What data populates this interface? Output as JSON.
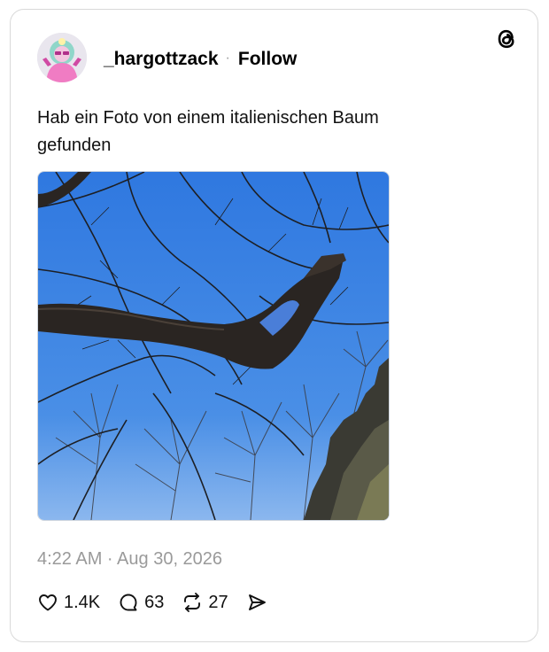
{
  "post": {
    "username": "_hargottzack",
    "separator": "·",
    "follow_label": "Follow",
    "text": "Hab ein Foto von einem italienischen Baum gefunden",
    "image_alt": "Photo of bare tree branches against a blue sky",
    "timestamp": "4:22 AM · Aug 30, 2026"
  },
  "actions": {
    "likes": "1.4K",
    "replies": "63",
    "reposts": "27"
  },
  "icons": {
    "logo": "threads-logo-icon",
    "like": "heart-icon",
    "reply": "comment-bubble-icon",
    "repost": "repost-icon",
    "share": "send-icon"
  },
  "colors": {
    "text": "#111111",
    "muted": "#9a9a9a",
    "border": "#d9d9d9",
    "sky": "#3f86e8"
  }
}
